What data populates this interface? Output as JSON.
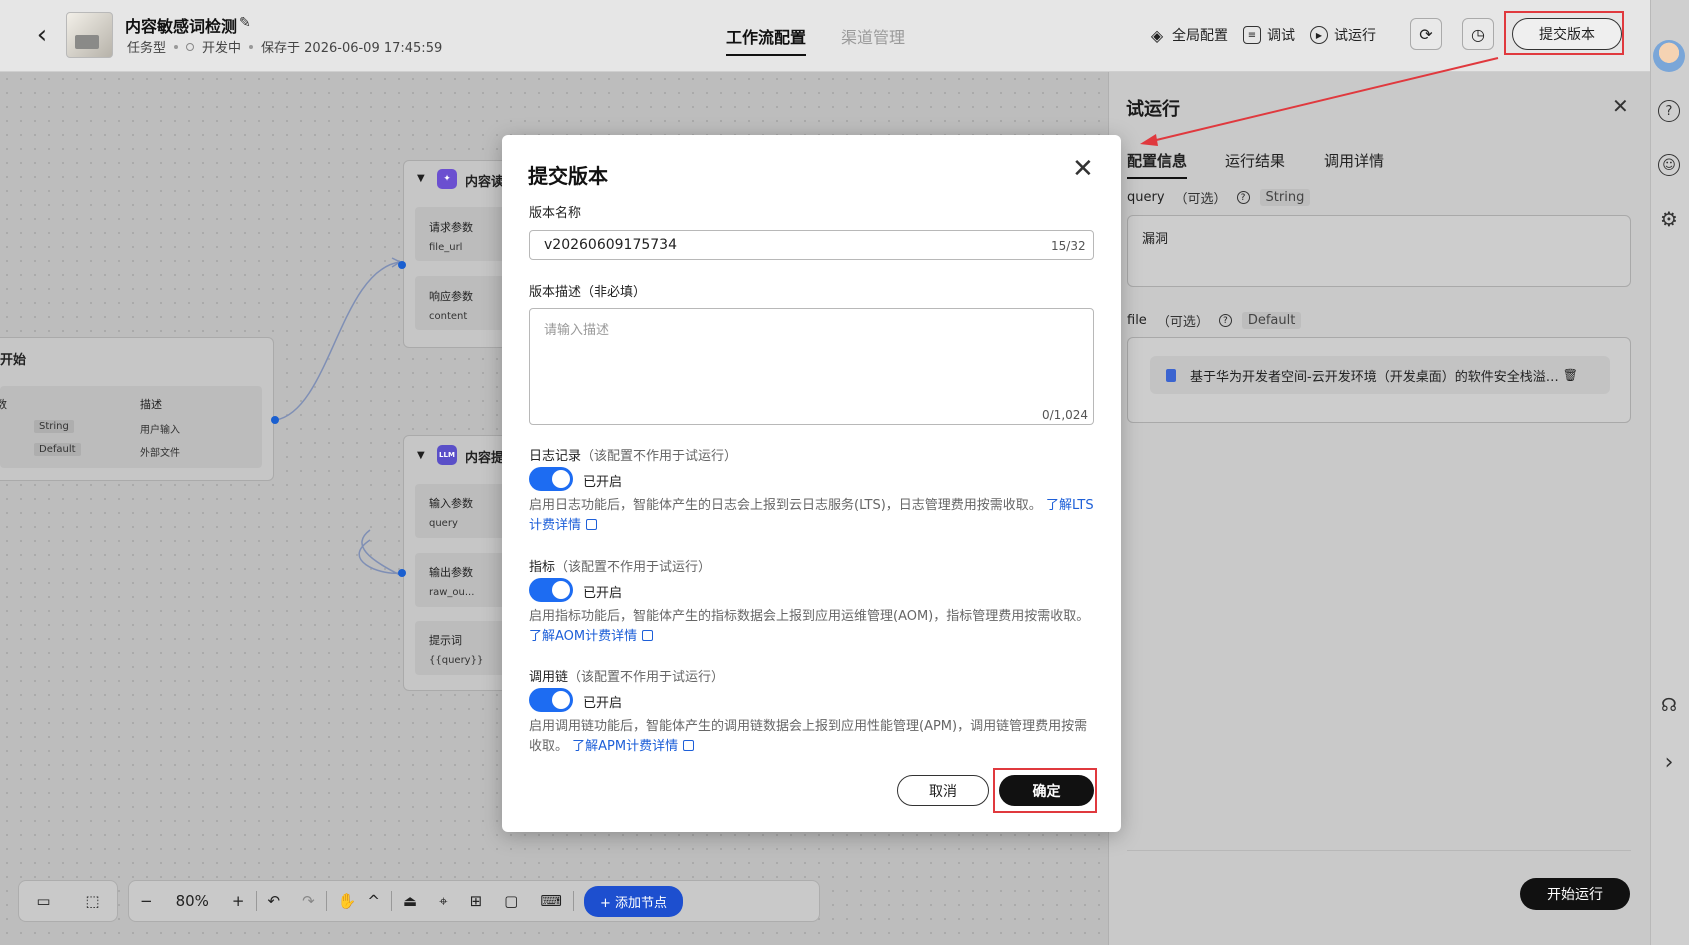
{
  "header": {
    "title": "内容敏感词检测",
    "meta": [
      "任务型",
      "开发中",
      "保存于 2026-06-09 17:45:59"
    ],
    "tabs": [
      "工作流配置",
      "渠道管理"
    ],
    "actions": [
      {
        "label": "全局配置",
        "icon": "layers-icon"
      },
      {
        "label": "调试",
        "icon": "debug-icon"
      },
      {
        "label": "试运行",
        "icon": "play-icon"
      }
    ],
    "submit_label": "提交版本"
  },
  "canvas": {
    "nodes": [
      {
        "title": "内容读",
        "params": [
          {
            "label": "请求参数",
            "value": "file_url"
          },
          {
            "label": "响应参数",
            "value": "content"
          }
        ]
      },
      {
        "title": "开始",
        "columns": [
          "数",
          "描述"
        ],
        "rows": [
          [
            "String",
            "用户输入"
          ],
          [
            "Default",
            "外部文件"
          ]
        ]
      },
      {
        "title": "内容提",
        "badge": "LLM",
        "params": [
          {
            "label": "输入参数",
            "value": "query"
          },
          {
            "label": "输出参数",
            "value": "raw_ou..."
          },
          {
            "label": "提示词",
            "value": "{{query}}"
          }
        ]
      }
    ],
    "toolbar": {
      "zoom": "80%",
      "add_node": "添加节点"
    }
  },
  "right_panel": {
    "title": "试运行",
    "tabs": [
      "配置信息",
      "运行结果",
      "调用详情"
    ],
    "query": {
      "name": "query",
      "optional": "（可选）",
      "type": "String",
      "value": "漏洞"
    },
    "file": {
      "name": "file",
      "optional": "（可选）",
      "type": "Default",
      "file_name": "基于华为开发者空间-云开发环境（开发桌面）的软件安全栈溢…"
    },
    "start_label": "开始运行"
  },
  "modal": {
    "title": "提交版本",
    "version_name_label": "版本名称",
    "version_name_value": "v20260609175734",
    "version_name_count": "15/32",
    "desc_label": "版本描述（非必填）",
    "desc_placeholder": "请输入描述",
    "desc_count": "0/1,024",
    "sections": [
      {
        "title": "日志记录",
        "note": "（该配置不作用于试运行）",
        "toggle": "已开启",
        "desc": "启用日志功能后，智能体产生的日志会上报到云日志服务(LTS)，日志管理费用按需收取。",
        "link": "了解LTS计费详情"
      },
      {
        "title": "指标",
        "note": "（该配置不作用于试运行）",
        "toggle": "已开启",
        "desc": "启用指标功能后，智能体产生的指标数据会上报到应用运维管理(AOM)，指标管理费用按需收取。",
        "link": "了解AOM计费详情"
      },
      {
        "title": "调用链",
        "note": "（该配置不作用于试运行）",
        "toggle": "已开启",
        "desc": "启用调用链功能后，智能体产生的调用链数据会上报到应用性能管理(APM)，调用链管理费用按需收取。",
        "link": "了解APM计费详情"
      }
    ],
    "cancel_label": "取消",
    "ok_label": "确定"
  },
  "colors": {
    "accent": "#1d6cf2",
    "highlight": "#e0393e",
    "primary_button": "#111111"
  }
}
